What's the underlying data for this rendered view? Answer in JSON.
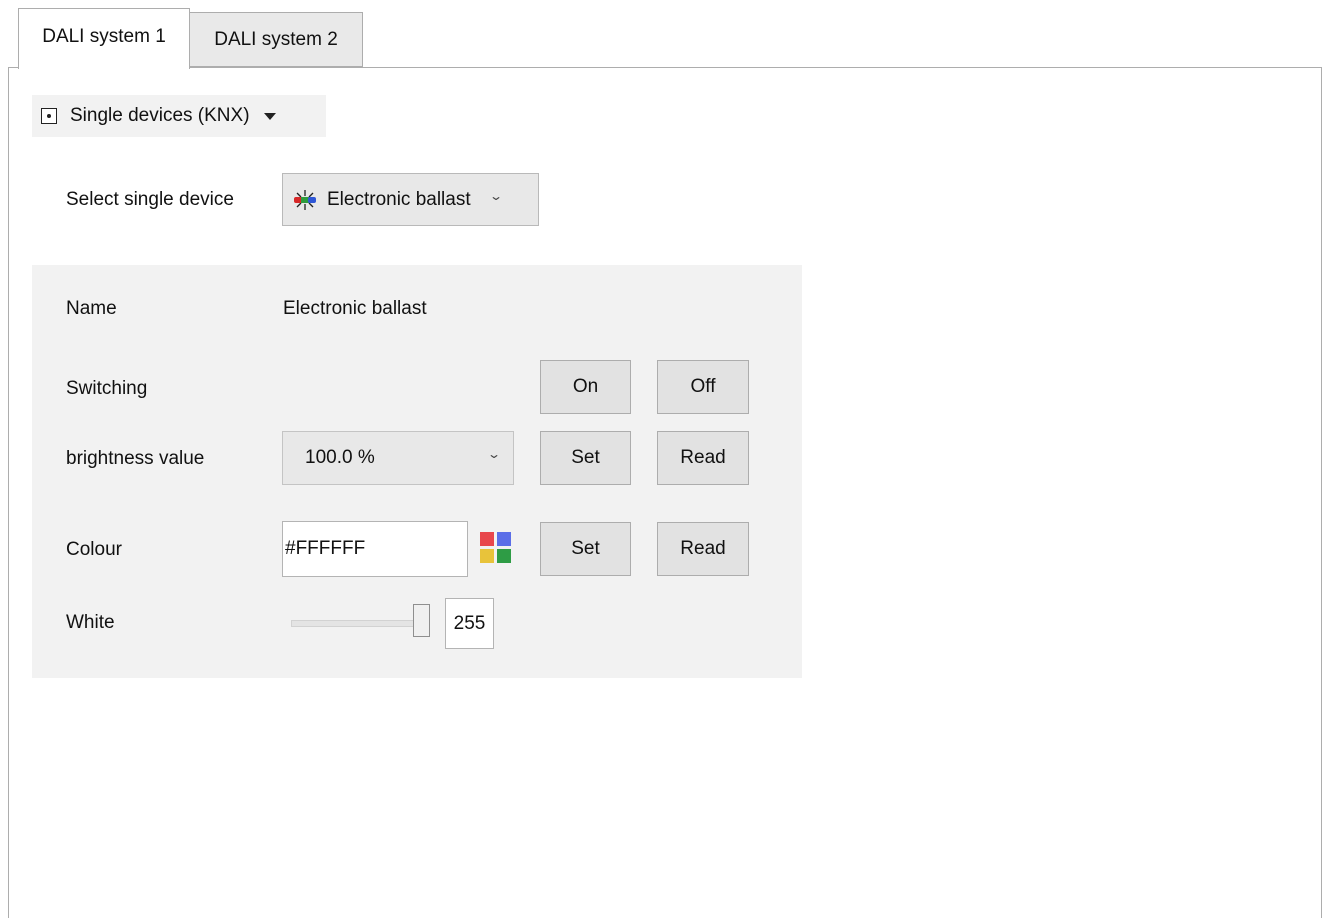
{
  "tabs": [
    {
      "label": "DALI system 1",
      "active": true
    },
    {
      "label": "DALI system 2",
      "active": false
    }
  ],
  "mode_dropdown": {
    "icon": "single-device-icon",
    "label": "Single devices (KNX)"
  },
  "device_select": {
    "label": "Select single device",
    "icon": "electronic-ballast-icon",
    "value": "Electronic ballast"
  },
  "details": {
    "name_label": "Name",
    "name_value": "Electronic ballast",
    "switching": {
      "label": "Switching",
      "on_button": "On",
      "off_button": "Off"
    },
    "brightness": {
      "label": "brightness value",
      "value": "100.0 %",
      "set_button": "Set",
      "read_button": "Read"
    },
    "colour": {
      "label": "Colour",
      "value": "#FFFFFF",
      "palette_icon": "color-palette-icon",
      "palette_colors": [
        "#e8474c",
        "#5b6ee8",
        "#e8c33a",
        "#2e9c45"
      ],
      "set_button": "Set",
      "read_button": "Read"
    },
    "white": {
      "label": "White",
      "value": "255",
      "slider_max": 255
    }
  },
  "colors": {
    "panel_background": "#f2f2f2",
    "button_background": "#e2e2e2",
    "border": "#adadad"
  }
}
